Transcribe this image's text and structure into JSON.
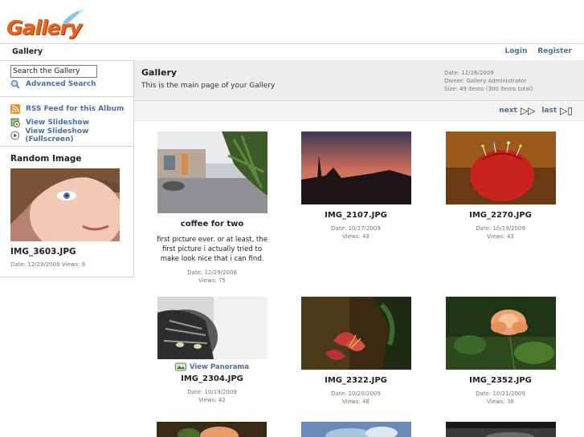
{
  "logo": {
    "text": "Gallery"
  },
  "breadcrumb": {
    "label": "Gallery"
  },
  "auth": {
    "login": "Login",
    "register": "Register"
  },
  "sidebar": {
    "search_placeholder": "Search the Gallery",
    "advanced_search": "Advanced Search",
    "rss": "RSS Feed for this Album",
    "slideshow": "View Slideshow",
    "slideshow_full": "View Slideshow (Fullscreen)",
    "random_heading": "Random Image",
    "random_title": "IMG_3603.JPG",
    "random_meta": "Date: 12/29/2009 Views: 9"
  },
  "album": {
    "title": "Gallery",
    "description": "This is the main page of your Gallery",
    "date": "Date: 12/26/2009",
    "owner": "Owner: Gallery Administrator",
    "size": "Size: 49 items (300 items total)"
  },
  "pager": {
    "next": "next",
    "last": "last"
  },
  "items": [
    {
      "title": "coffee for two",
      "summary": "first picture ever. or at least, the first picture i actually tried to make look nice that i can find.",
      "date": "Date: 12/29/2008",
      "views": "Views: 75"
    },
    {
      "title": "IMG_2107.JPG",
      "date": "Date: 10/17/2009",
      "views": "Views: 43"
    },
    {
      "title": "IMG_2270.JPG",
      "date": "Date: 10/19/2009",
      "views": "Views: 43"
    },
    {
      "title": "IMG_2304.JPG",
      "panorama": "View Panorama",
      "date": "Date: 10/19/2009",
      "views": "Views: 42"
    },
    {
      "title": "IMG_2322.JPG",
      "date": "Date: 10/20/2009",
      "views": "Views: 48"
    },
    {
      "title": "IMG_2352.JPG",
      "date": "Date: 10/21/2009",
      "views": "Views: 38"
    }
  ],
  "colors": {
    "link": "#4a6fa5",
    "logo": "#e8641c",
    "header_bg": "#eeeeee"
  }
}
